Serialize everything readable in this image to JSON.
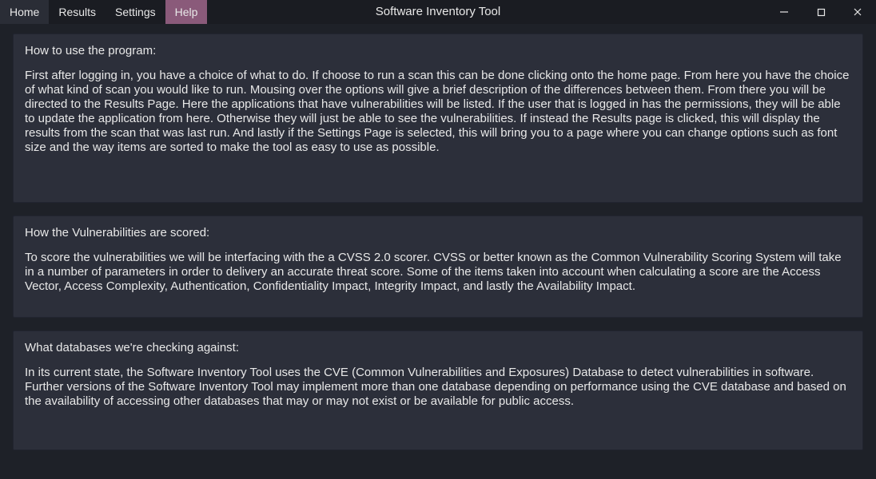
{
  "window": {
    "title": "Software Inventory Tool"
  },
  "menu": {
    "home": "Home",
    "results": "Results",
    "settings": "Settings",
    "help": "Help"
  },
  "sections": {
    "howto": {
      "heading": "How to use the program:",
      "body": "First after logging in, you have a choice of what to do. If choose to run a scan this can be done  clicking onto the home page. From here you have the choice of what kind of scan you would like to run.  Mousing over the options will give a brief description of the differences between them. From there you will be directed to the Results Page. Here the applications that have vulnerabilities will be listed. If  the user that is logged in has the permissions, they will be able to update the application from here.  Otherwise they will just be able to see the vulnerabilities. If instead the Results page is clicked,  this will display the results from the scan that was last run. And lastly if the Settings Page is selected,  this will bring you to a page where you can change options such as font size and the way items are sorted to make the  tool as easy to use as possible."
    },
    "scored": {
      "heading": "How the Vulnerabilities are scored:",
      "body": "To score the vulnerabilities we will be interfacing with the a CVSS 2.0 scorer. CVSS or better known as the Common Vulnerability Scoring System will take in a number of parameters in order to delivery an accurate threat score. Some of the items taken into account when calculating a score are the Access Vector, Access Complexity, Authentication, Confidentiality Impact, Integrity Impact, and lastly the Availability Impact."
    },
    "databases": {
      "heading": "What databases we're checking against:",
      "body": "In its current state, the Software Inventory Tool uses the CVE (Common Vulnerabilities and Exposures) Database to detect vulnerabilities in software. Further versions of the Software Inventory Tool may implement more than one database depending on performance using the CVE database and based on the availability of accessing other databases that may or may not exist or be available for public access."
    }
  }
}
